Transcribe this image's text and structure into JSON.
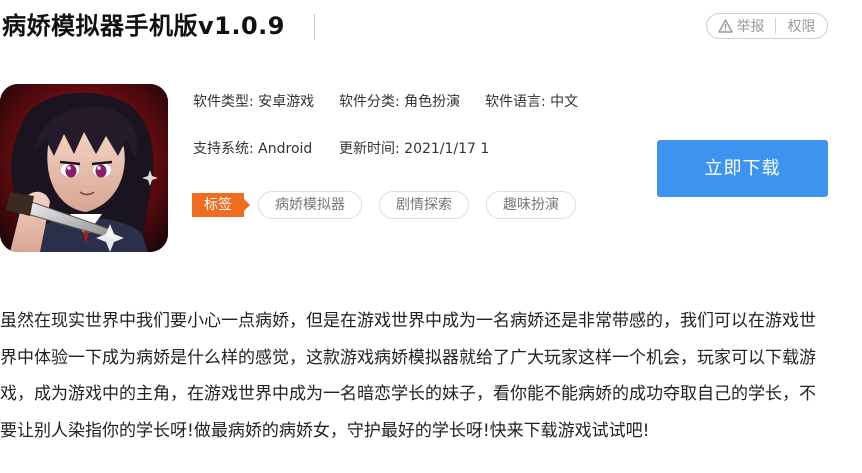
{
  "header": {
    "title": "病娇模拟器手机版v1.0.9",
    "report_label": "举报",
    "rights_label": "权限"
  },
  "info": {
    "type_label": "软件类型:",
    "type_value": "安卓游戏",
    "category_label": "软件分类:",
    "category_value": "角色扮演",
    "language_label": "软件语言:",
    "language_value": "中文",
    "system_label": "支持系统:",
    "system_value": "Android",
    "updated_label": "更新时间:",
    "updated_value": "2021/1/17 1"
  },
  "tags": {
    "label": "标签",
    "items": [
      "病娇模拟器",
      "剧情探索",
      "趣味扮演"
    ]
  },
  "download": {
    "label": "立即下载",
    "color": "#3c94f0"
  },
  "description": "虽然在现实世界中我们要小心一点病娇，但是在游戏世界中成为一名病娇还是非常带感的，我们可以在游戏世界中体验一下成为病娇是什么样的感觉，这款游戏病娇模拟器就给了广大玩家这样一个机会，玩家可以下载游戏，成为游戏中的主角，在游戏世界中成为一名暗恋学长的妹子，看你能不能病娇的成功夺取自己的学长，不要让别人染指你的学长呀!做最病娇的病娇女，守护最好的学长呀!快来下载游戏试试吧!",
  "colors": {
    "tag_accent": "#f06c1e",
    "download_button": "#3c94f0"
  },
  "icons": {
    "report": "warning-triangle-icon",
    "app": "game-app-icon"
  }
}
